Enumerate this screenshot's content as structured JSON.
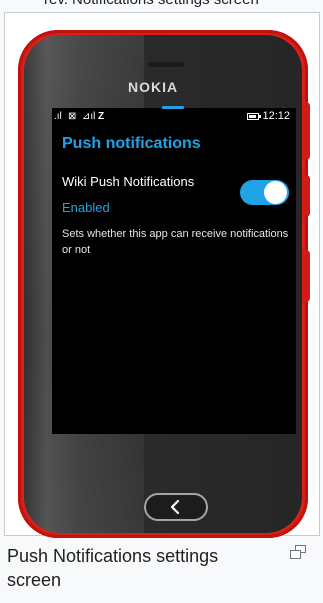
{
  "top_caption": "rev. Notifications settings screen",
  "phone": {
    "brand": "NOKIA",
    "status_bar": {
      "signal_1": ".ıl",
      "signal_2": "⊠",
      "signal_3": "⊿ıl",
      "signal_4": "Z",
      "time": "12:12"
    },
    "screen": {
      "title": "Push notifications",
      "setting": {
        "title": "Wiki Push Notifications",
        "value": "Enabled",
        "description": "Sets whether this app can receive notifications or not",
        "enabled": true
      }
    }
  },
  "caption": "Push Notifications settings screen",
  "colors": {
    "accent": "#1fa3e6",
    "phone_body": "#e8221c",
    "screen_bg": "#000000"
  },
  "icons": {
    "back": "chevron-left-icon",
    "enlarge": "enlarge-icon"
  }
}
